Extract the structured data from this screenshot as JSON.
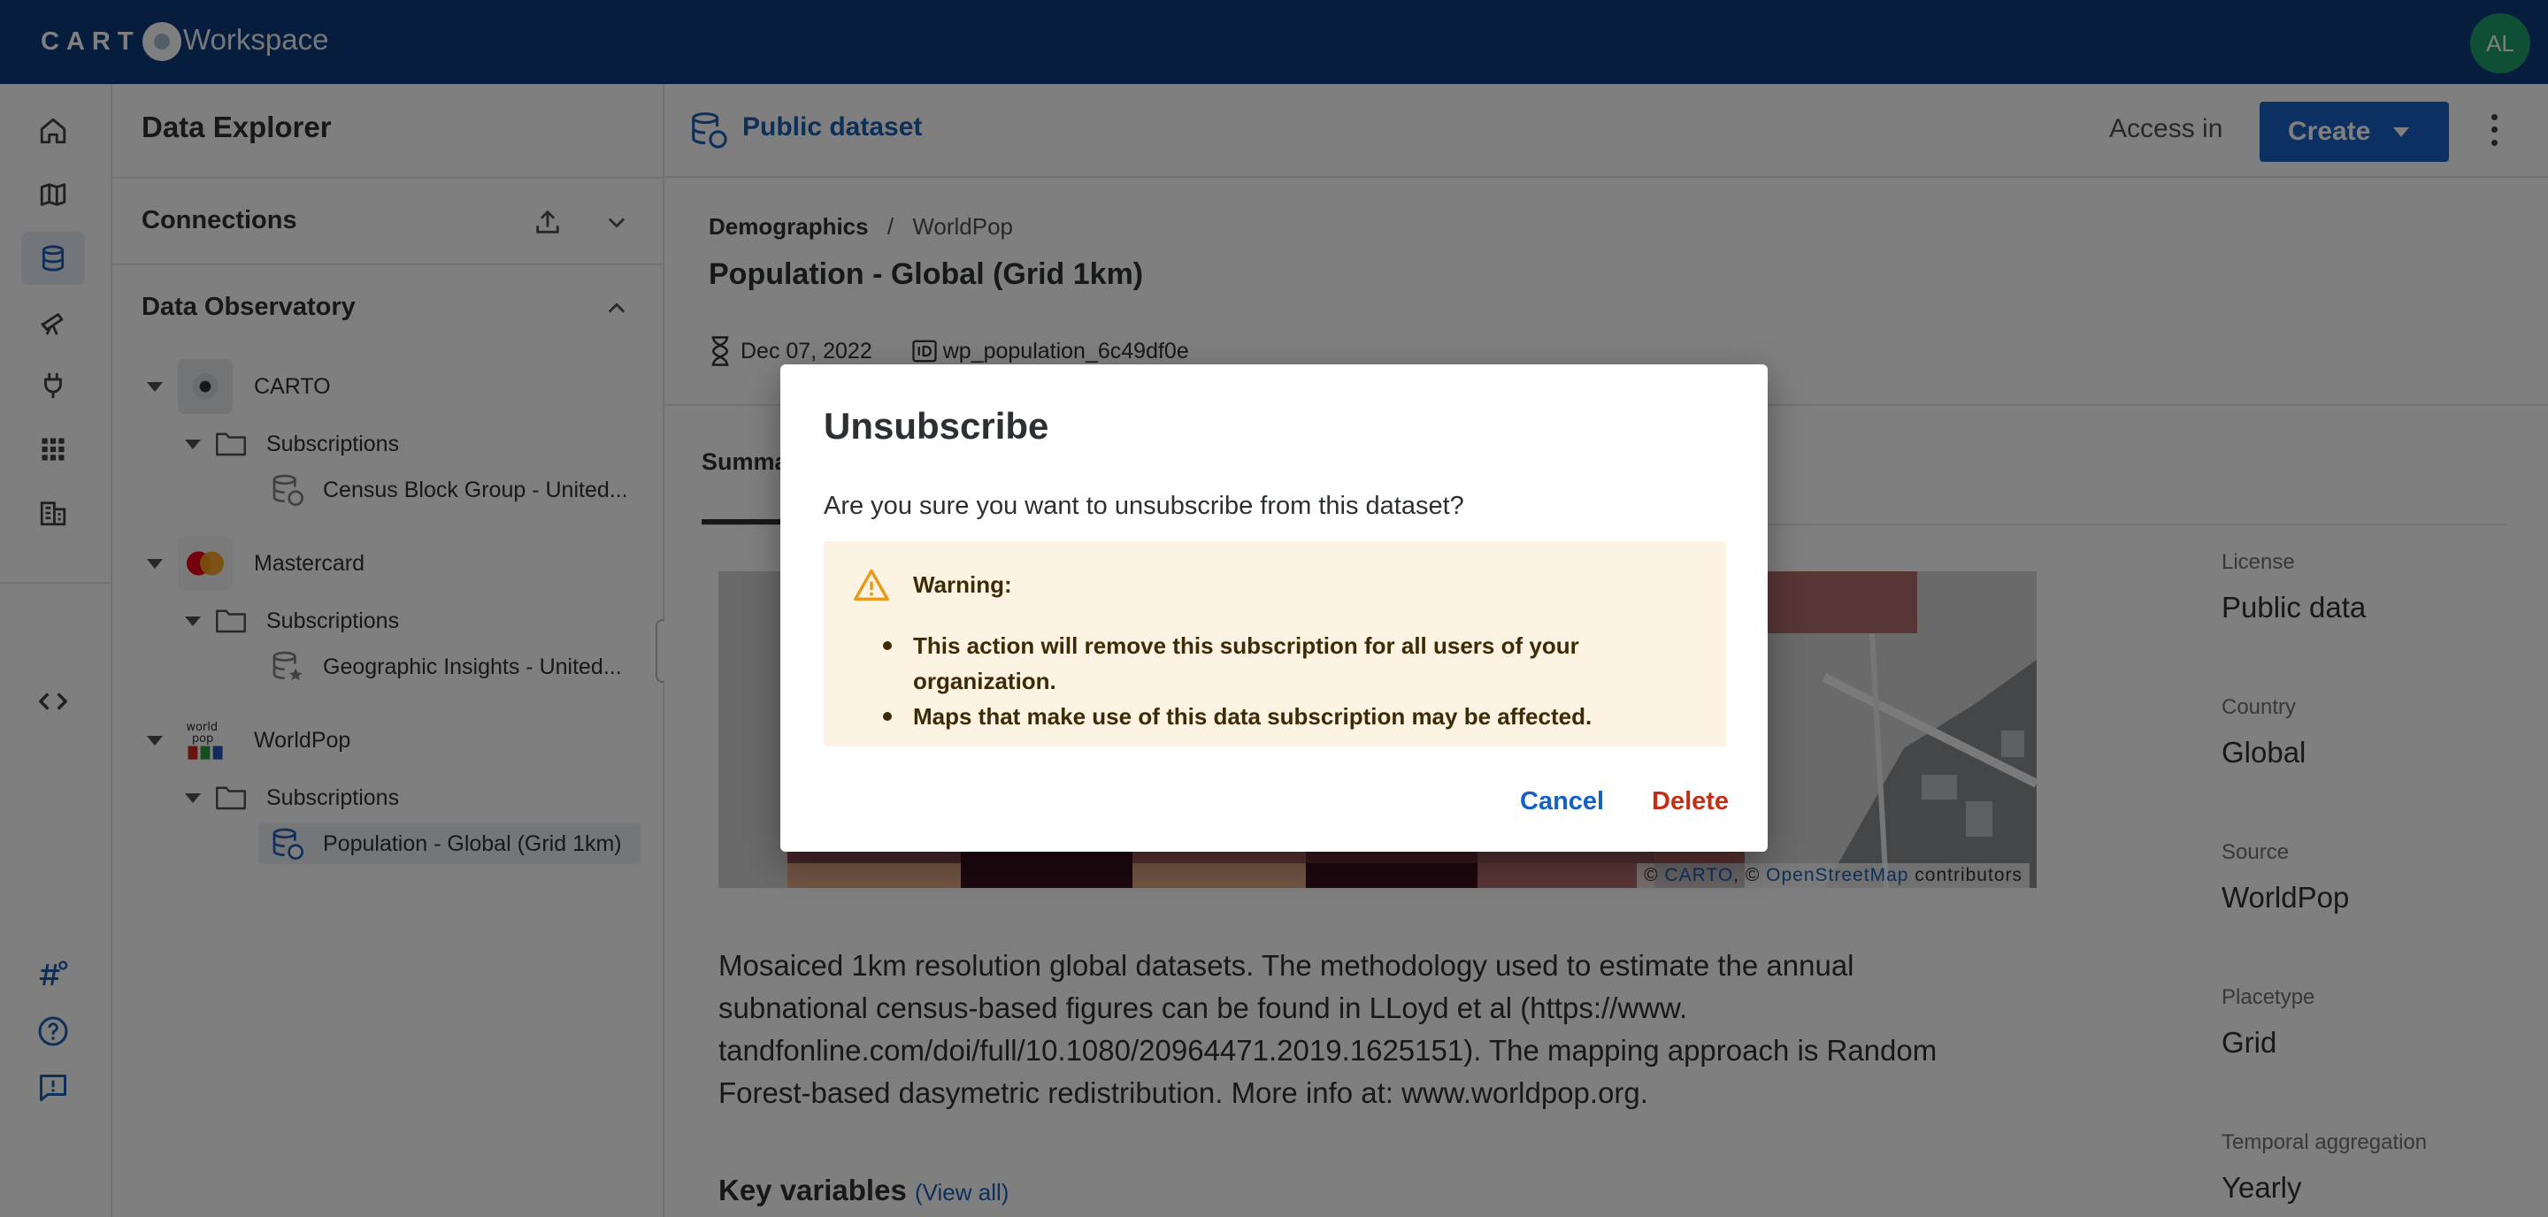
{
  "app": {
    "logo_text": "CART",
    "workspace_label": "Workspace",
    "user_initials": "AL",
    "brand_color": "#0f3b7a"
  },
  "nav_rail": {
    "items": [
      {
        "name": "home",
        "icon": "home-icon"
      },
      {
        "name": "maps",
        "icon": "map-icon"
      },
      {
        "name": "data-explorer",
        "icon": "database-icon",
        "active": true
      },
      {
        "name": "data-observatory",
        "icon": "telescope-icon"
      },
      {
        "name": "connections",
        "icon": "plug-icon"
      },
      {
        "name": "applications",
        "icon": "grid-icon"
      },
      {
        "name": "organization",
        "icon": "building-icon"
      },
      {
        "name": "developers",
        "icon": "code-icon"
      }
    ],
    "bottom_items": [
      {
        "name": "whats-new",
        "icon": "hashtag-icon"
      },
      {
        "name": "help",
        "icon": "help-icon"
      },
      {
        "name": "feedback",
        "icon": "feedback-icon"
      }
    ]
  },
  "explorer": {
    "title": "Data Explorer",
    "connections_label": "Connections",
    "observatory_label": "Data Observatory",
    "providers": [
      {
        "name": "CARTO",
        "folder": "Subscriptions",
        "dataset": "Census Block Group - United..."
      },
      {
        "name": "Mastercard",
        "folder": "Subscriptions",
        "dataset": "Geographic Insights - United..."
      },
      {
        "name": "WorldPop",
        "folder": "Subscriptions",
        "dataset": "Population - Global (Grid 1km)",
        "selected": true
      }
    ]
  },
  "main": {
    "header_label": "Public dataset",
    "access_in_label": "Access in",
    "create_label": "Create",
    "breadcrumb": {
      "category": "Demographics",
      "separator": "/",
      "provider": "WorldPop"
    },
    "title": "Population - Global (Grid 1km)",
    "date": "Dec 07, 2022",
    "dataset_id": "wp_population_6c49df0e",
    "tab_label": "Summa",
    "map_attribution": {
      "copyright_1": "©",
      "carto_link": "CARTO",
      "copyright_2": ", ©",
      "osm_link": "OpenStreetMap",
      "suffix": "contributors"
    },
    "description_lines": [
      "Mosaiced 1km resolution global datasets. The methodology used to estimate the annual",
      "subnational census-based figures can be found in LLoyd et al (https://www.",
      "tandfonline.com/doi/full/10.1080/20964471.2019.1625151). The mapping approach is Random",
      "Forest-based dasymetric redistribution. More info at: www.worldpop.org."
    ],
    "key_variables_label": "Key variables",
    "view_all_label": "(View all)",
    "side_meta": [
      {
        "label": "License",
        "value": "Public data"
      },
      {
        "label": "Country",
        "value": "Global"
      },
      {
        "label": "Source",
        "value": "WorldPop"
      },
      {
        "label": "Placetype",
        "value": "Grid"
      },
      {
        "label": "Temporal aggregation",
        "value": "Yearly"
      }
    ]
  },
  "dialog": {
    "title": "Unsubscribe",
    "question": "Are you sure you want to unsubscribe from this dataset?",
    "warning_title": "Warning:",
    "warning_items": [
      "This action will remove this subscription for all users of your organization.",
      "Maps that make use of this data subscription may be affected."
    ],
    "cancel_label": "Cancel",
    "delete_label": "Delete",
    "accent_color": "#1660c3",
    "danger_color": "#c62d15",
    "warning_bg": "#fdf3e3"
  }
}
